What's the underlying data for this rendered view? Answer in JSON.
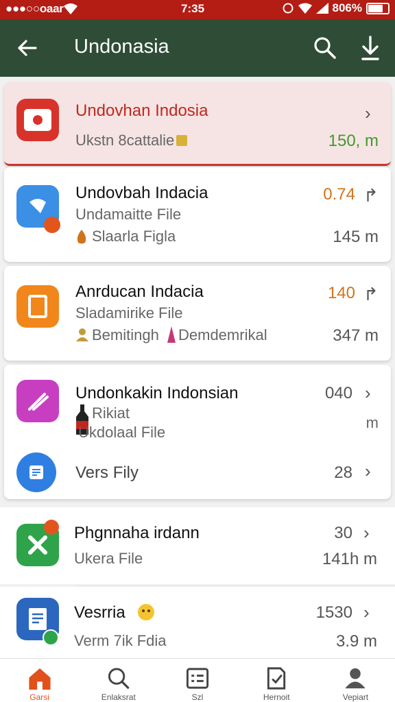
{
  "status_bar": {
    "carrier": "●●●○○oaar",
    "time": "7:35",
    "battery": "806%"
  },
  "app_bar": {
    "title": "Undonasia"
  },
  "items": [
    {
      "title": "Undovhan Indosia",
      "line2": "Ukstn 8cattalie",
      "value": "150, m"
    },
    {
      "title": "Undovbah Indacia",
      "line2": "Undamaitte File",
      "line3": "Slaarla Figla",
      "value": "0.74",
      "value2": "145 m"
    },
    {
      "title": "Anrducan Indacia",
      "line2": "Sladamirike File",
      "line3a": "Bemitingh",
      "line3b": "Demdemrikal",
      "value": "140",
      "value2": "347 m"
    },
    {
      "title": "Undonkakin Indonsian",
      "line2": "Rikiat",
      "line3": "Ukdolaal File",
      "value": "040",
      "value2": "m"
    },
    {
      "title": "Vers Fily",
      "value": "28"
    },
    {
      "title": "Phgnnaha irdann",
      "line2": "Ukera File",
      "value": "30",
      "value2": "141h m"
    },
    {
      "title": "Vesrria",
      "line2": "Verm 7ik Fdia",
      "value": "1530",
      "value2": "3.9 m"
    }
  ],
  "bottom_nav": [
    {
      "label": "Garsi",
      "icon": "home-icon"
    },
    {
      "label": "Enlaksrat",
      "icon": "search-icon"
    },
    {
      "label": "Szl",
      "icon": "list-icon"
    },
    {
      "label": "Hernoit",
      "icon": "document-check-icon"
    },
    {
      "label": "Vepiart",
      "icon": "profile-icon"
    }
  ],
  "colors": {
    "status_bar": "#b31d14",
    "app_bar": "#2f4d36",
    "accent_red": "#c1271e",
    "accent_orange": "#d0741c",
    "accent_green": "#3f9b2a"
  }
}
